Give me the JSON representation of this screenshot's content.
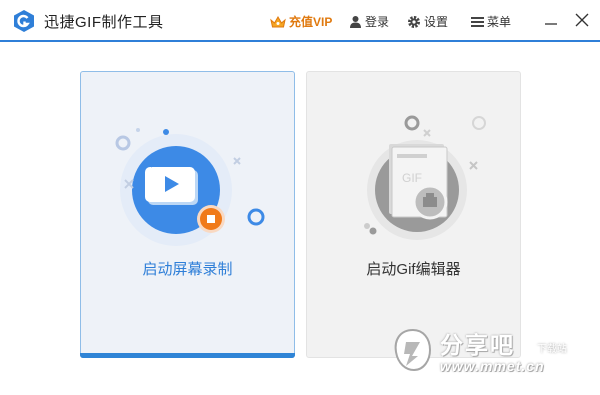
{
  "titlebar": {
    "app_title": "迅捷GIF制作工具",
    "vip_label": "充值VIP",
    "login_label": "登录",
    "settings_label": "设置",
    "menu_label": "菜单",
    "icons": [
      "app-logo-icon",
      "crown-icon",
      "user-icon",
      "gear-icon",
      "menu-icon",
      "minimize-icon",
      "close-icon"
    ]
  },
  "cards": {
    "record": {
      "label": "启动屏幕录制",
      "icon": "video-record-icon",
      "selected": true
    },
    "gif_editor": {
      "label": "启动Gif编辑器",
      "icon": "gif-editor-icon",
      "selected": false
    }
  },
  "watermark": {
    "main": "分享吧",
    "sub": "下载站",
    "url": "www.mmet.cn"
  },
  "colors": {
    "accent": "#2f7fd8",
    "vip": "#e07a10",
    "record_card_bg": "#eef2f8",
    "gif_card_bg": "#f2f2f2",
    "record_button": "#f07a1a"
  }
}
